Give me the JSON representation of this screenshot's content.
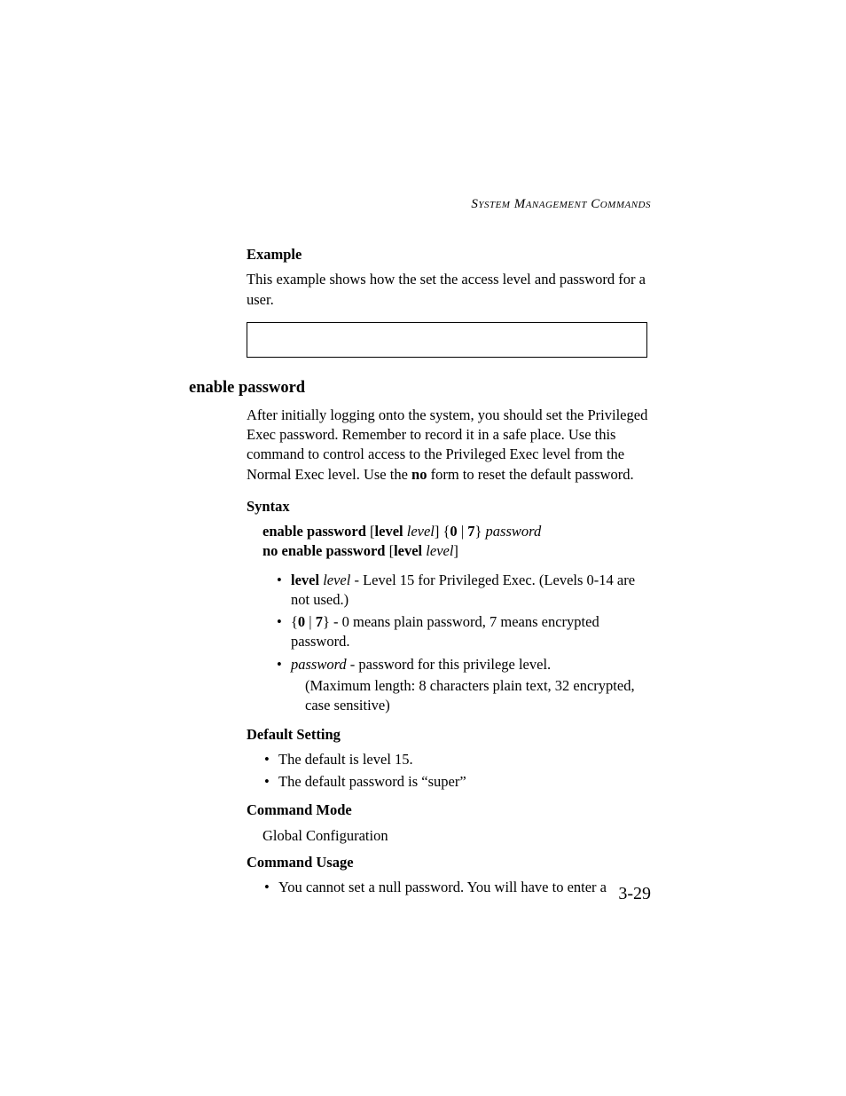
{
  "running_head": "System Management Commands",
  "example": {
    "heading": "Example",
    "text": "This example shows how the set the access level and password for a user."
  },
  "section": {
    "heading": "enable password",
    "intro_1": "After initially logging onto the system, you should set the Privileged Exec password. Remember to record it in a safe place. Use this command to control access to the Privileged Exec level from the Normal Exec level. Use the ",
    "intro_no": "no",
    "intro_2": " form to reset the default password."
  },
  "syntax": {
    "heading": "Syntax",
    "line1": {
      "a": "enable password",
      "b": " [",
      "c": "level",
      "d": " ",
      "e": "level",
      "f": "] {",
      "g": "0",
      "h": " | ",
      "i": "7",
      "j": "} ",
      "k": "password"
    },
    "line2": {
      "a": "no enable password",
      "b": " [",
      "c": "level",
      "d": " ",
      "e": "level",
      "f": "]"
    },
    "bullets": {
      "b1": {
        "a": "level",
        "b": " ",
        "c": "level",
        "d": " - Level 15 for Privileged Exec. (Levels 0-14 are not used.)"
      },
      "b2": {
        "a": "{",
        "b": "0",
        "c": " | ",
        "d": "7",
        "e": "} - 0 means plain password, 7 means encrypted password."
      },
      "b3": {
        "a": "password",
        "b": " - password for this privilege level.",
        "note": "(Maximum length: 8 characters plain text, 32 encrypted, case sensitive)"
      }
    }
  },
  "default_setting": {
    "heading": "Default Setting",
    "b1": "The default is level 15.",
    "b2": "The default password is “super”"
  },
  "command_mode": {
    "heading": "Command Mode",
    "text": "Global Configuration"
  },
  "command_usage": {
    "heading": "Command Usage",
    "b1": "You cannot set a null password. You will have to enter a"
  },
  "page_number": "3-29"
}
